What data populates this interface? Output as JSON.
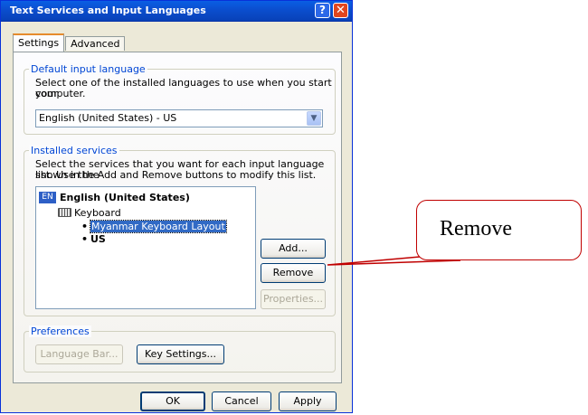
{
  "window": {
    "title": "Text Services and Input Languages",
    "help_glyph": "?",
    "close_glyph": "✕"
  },
  "tabs": [
    {
      "label": "Settings",
      "active": true
    },
    {
      "label": "Advanced",
      "active": false
    }
  ],
  "default_input": {
    "legend": "Default input language",
    "description_line1": "Select one of the installed languages to use when you start your",
    "description_line2": "computer.",
    "selected": "English (United States) - US",
    "arrow_glyph": "▼"
  },
  "installed_services": {
    "legend": "Installed services",
    "description_line1": "Select the services that you want for each input language shown in the",
    "description_line2": "list. Use the Add and Remove buttons to modify this list.",
    "tree": {
      "language_badge": "EN",
      "language": "English (United States)",
      "category": "Keyboard",
      "bullet": "•",
      "items": [
        "Myanmar Keyboard Layout",
        "US"
      ],
      "selected_index": 0
    },
    "buttons": {
      "add": "Add...",
      "remove": "Remove",
      "properties": "Properties..."
    }
  },
  "preferences": {
    "legend": "Preferences",
    "language_bar": "Language Bar...",
    "key_settings": "Key Settings..."
  },
  "footer": {
    "ok": "OK",
    "cancel": "Cancel",
    "apply": "Apply"
  },
  "callout": {
    "text": "Remove"
  },
  "colors": {
    "titlebar": "#0b4fd0",
    "dialog_bg": "#ece9d8",
    "selection": "#316ac5",
    "callout_border": "#c00000",
    "legend_text": "#0046d5"
  }
}
